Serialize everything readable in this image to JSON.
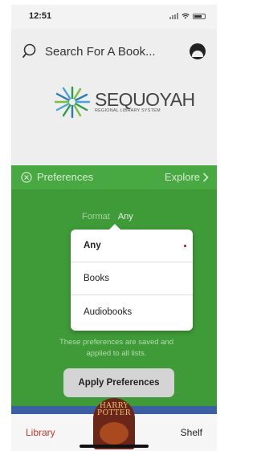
{
  "status_bar": {
    "time": "12:51"
  },
  "header": {
    "search_placeholder": "Search For A Book...",
    "logo_main": "SEQUOYAH",
    "logo_sub": "REGIONAL LIBRARY SYSTEM"
  },
  "preferences": {
    "title": "Preferences",
    "explore_label": "Explore",
    "format_label": "Format",
    "format_value": "Any",
    "note_line1": "These preferences are saved and",
    "note_line2": "applied to all lists.",
    "apply_label": "Apply Preferences"
  },
  "dropdown": {
    "options": [
      "Any",
      "Books",
      "Audiobooks"
    ],
    "selected": "Any"
  },
  "tabbar": {
    "library_label": "Library",
    "shelf_label": "Shelf",
    "book_title_line1": "HARRY",
    "book_title_line2": "POTTER"
  },
  "colors": {
    "accent_green": "#48a841",
    "library_red": "#c0392b"
  }
}
